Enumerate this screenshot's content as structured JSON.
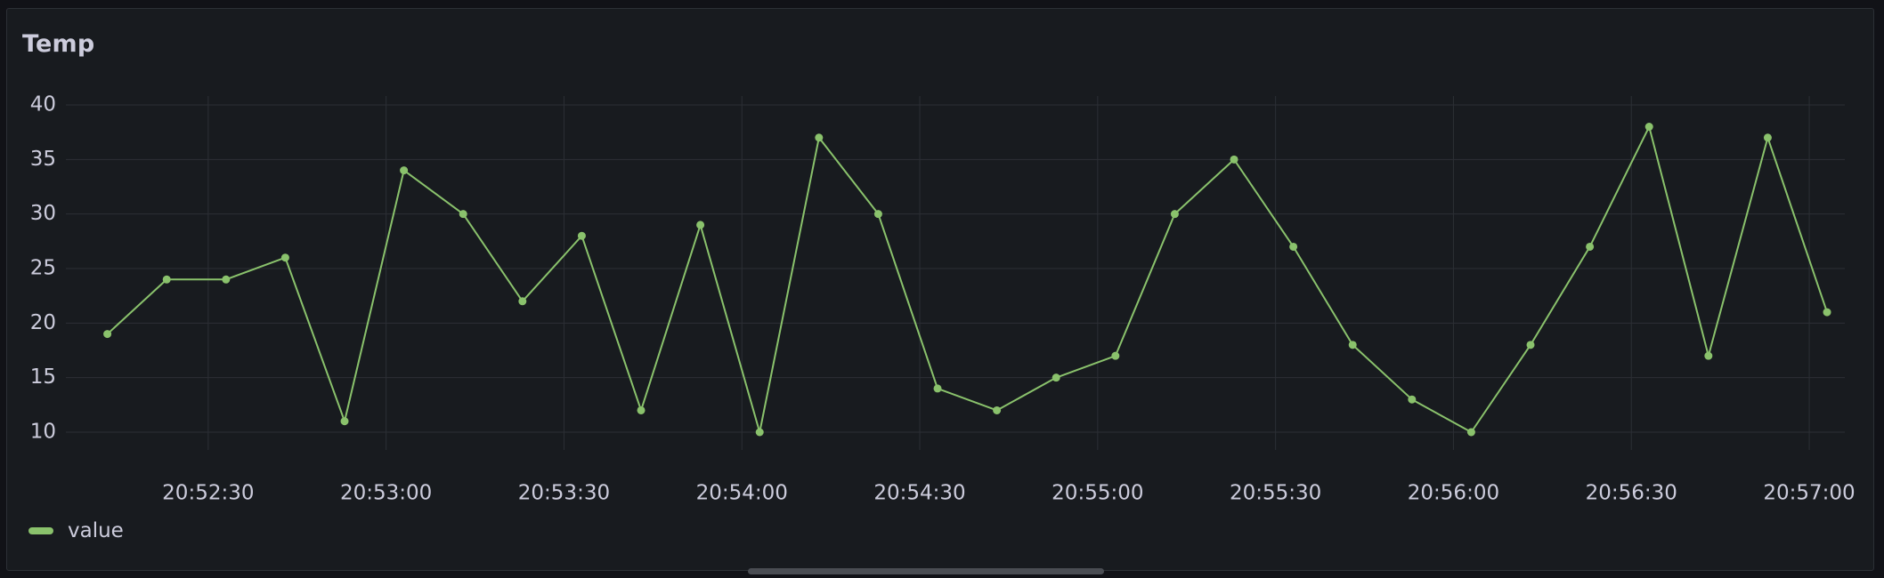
{
  "panel": {
    "title": "Temp"
  },
  "colors": {
    "series": "#8ac26c",
    "grid": "#2c2f35",
    "text": "#ccccdc",
    "background": "#181b1f"
  },
  "chart_data": {
    "type": "line",
    "title": "Temp",
    "xlabel": "",
    "ylabel": "",
    "ylim": [
      10,
      40
    ],
    "xlim": [
      "20:52:06",
      "20:57:06"
    ],
    "y_ticks": [
      10,
      15,
      20,
      25,
      30,
      35,
      40
    ],
    "x_ticks": [
      "20:52:30",
      "20:53:00",
      "20:53:30",
      "20:54:00",
      "20:54:30",
      "20:55:00",
      "20:55:30",
      "20:56:00",
      "20:56:30",
      "20:57:00"
    ],
    "grid": true,
    "legend_position": "bottom-left",
    "series": [
      {
        "name": "value",
        "x": [
          "20:52:13",
          "20:52:23",
          "20:52:33",
          "20:52:43",
          "20:52:53",
          "20:53:03",
          "20:53:13",
          "20:53:23",
          "20:53:33",
          "20:53:43",
          "20:53:53",
          "20:54:03",
          "20:54:13",
          "20:54:23",
          "20:54:33",
          "20:54:43",
          "20:54:53",
          "20:55:03",
          "20:55:13",
          "20:55:23",
          "20:55:33",
          "20:55:43",
          "20:55:53",
          "20:56:03",
          "20:56:13",
          "20:56:23",
          "20:56:33",
          "20:56:43",
          "20:56:53",
          "20:57:03"
        ],
        "values": [
          19,
          24,
          24,
          26,
          11,
          34,
          30,
          22,
          28,
          12,
          29,
          10,
          37,
          30,
          14,
          12,
          15,
          17,
          30,
          35,
          27,
          18,
          13,
          10,
          18,
          27,
          38,
          17,
          37,
          21
        ]
      }
    ]
  }
}
